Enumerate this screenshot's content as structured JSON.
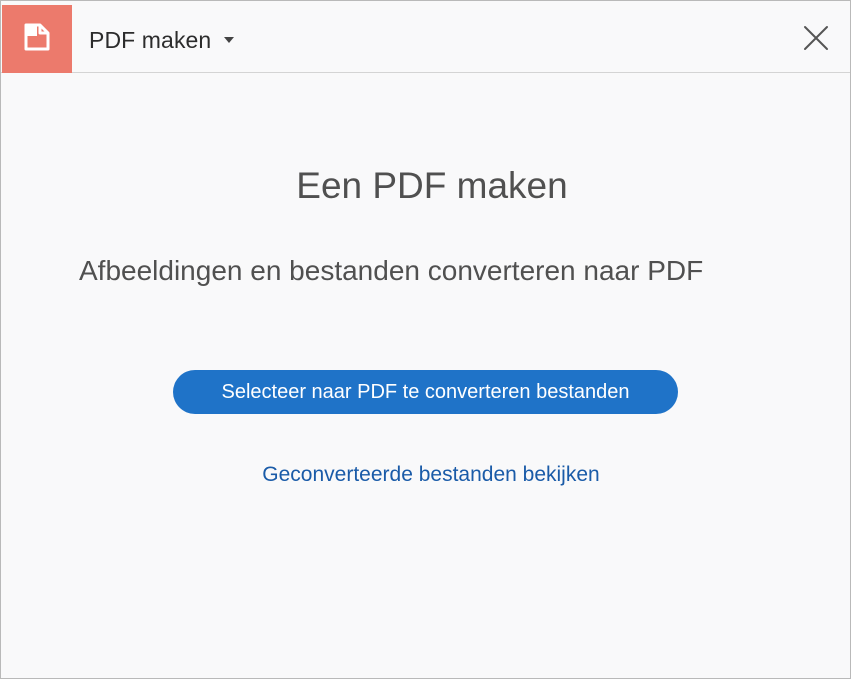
{
  "header": {
    "tool_icon": "create-pdf-icon",
    "tool_name": "PDF maken",
    "dropdown_icon": "caret-down-icon",
    "close_icon": "close-icon"
  },
  "main": {
    "heading": "Een PDF maken",
    "subheading": "Afbeeldingen en bestanden converteren naar PDF",
    "primary_button": "Selecteer naar PDF te converteren bestanden",
    "link": "Geconverteerde bestanden bekijken"
  },
  "colors": {
    "tool_tile": "#ec7a6c",
    "primary_button": "#1f73c8",
    "link": "#1a5ba8",
    "background": "#f9f9fa"
  }
}
